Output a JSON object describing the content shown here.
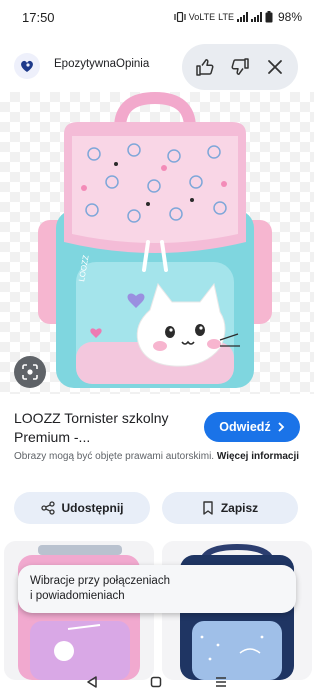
{
  "status_bar": {
    "time": "17:50",
    "network_label": "VoLTE",
    "lte_label": "LTE",
    "battery": "98%"
  },
  "site": {
    "name": "EpozytywnaOpinia",
    "actions": [
      "thumb-up-icon",
      "thumb-down-icon",
      "close-icon"
    ]
  },
  "image": {
    "main_color": "#7fd6df",
    "accent_color": "#f3b8d6"
  },
  "result": {
    "title": "LOOZZ Tornister szkolny Premium -...",
    "visit_label": "Odwiedź",
    "copyright": "Obrazy mogą być objęte prawami autorskimi.",
    "more_info": "Więcej informacji"
  },
  "actions": {
    "share_label": "Udostępnij",
    "save_label": "Zapisz"
  },
  "toast": {
    "line1": "Wibracje przy połączeniach",
    "line2": "i powiadomieniach"
  },
  "colors": {
    "accent": "#1a73e8",
    "pill_bg": "#e9ecf1",
    "button_bg": "#e8eef8"
  }
}
